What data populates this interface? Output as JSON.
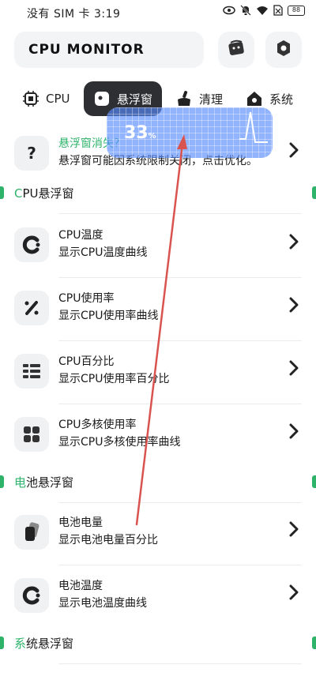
{
  "status_bar": {
    "carrier_time": "没有 SIM 卡 3:19",
    "battery": "88"
  },
  "header": {
    "app_title": "CPU MONITOR"
  },
  "tabs": [
    {
      "label": "CPU",
      "icon": "chip-icon"
    },
    {
      "label": "悬浮窗",
      "icon": "float-window-icon"
    },
    {
      "label": "清理",
      "icon": "broom-icon"
    },
    {
      "label": "系统",
      "icon": "home-icon"
    }
  ],
  "notice": {
    "title": "悬浮窗消失？",
    "desc": "悬浮窗可能因系统限制关闭，点击优化。"
  },
  "float_widget": {
    "value": "33",
    "unit": "%"
  },
  "sections": {
    "cpu": {
      "accent": "C",
      "rest": "PU悬浮窗"
    },
    "battery": {
      "accent": "电",
      "rest": "池悬浮窗"
    },
    "system": {
      "accent": "系",
      "rest": "统悬浮窗"
    }
  },
  "cpu_items": [
    {
      "title": "CPU温度",
      "desc": "显示CPU温度曲线",
      "icon": "c-ring-icon"
    },
    {
      "title": "CPU使用率",
      "desc": "显示CPU使用率曲线",
      "icon": "percent-icon"
    },
    {
      "title": "CPU百分比",
      "desc": "显示CPU使用率百分比",
      "icon": "bars-grid-icon"
    },
    {
      "title": "CPU多核使用率",
      "desc": "显示CPU多核使用率曲线",
      "icon": "four-squares-icon"
    }
  ],
  "battery_items": [
    {
      "title": "电池电量",
      "desc": "显示电池电量百分比",
      "icon": "battery-cards-icon"
    },
    {
      "title": "电池温度",
      "desc": "显示电池温度曲线",
      "icon": "c-ring-icon"
    }
  ],
  "colors": {
    "accent_green": "#2fb36b",
    "active_tab": "#2e2f33",
    "float_blue": "#588cff",
    "arrow_red": "#d9534f"
  }
}
